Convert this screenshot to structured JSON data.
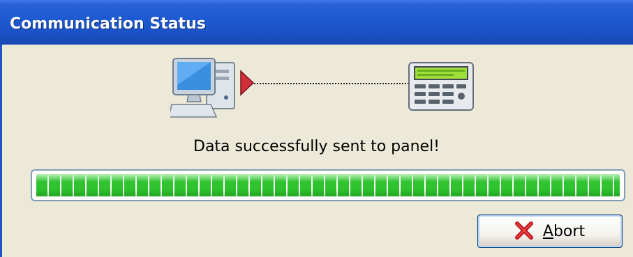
{
  "window": {
    "title": "Communication Status"
  },
  "status": {
    "message": "Data successfully sent to panel!"
  },
  "progress": {
    "percent": 100
  },
  "abort_button": {
    "mnemonic": "A",
    "label_rest": "bort"
  },
  "icons": {
    "computer": "computer-icon",
    "direction": "arrow-right-icon",
    "panel": "alarm-keypad-icon",
    "abort": "red-x-icon"
  },
  "colors": {
    "title_bar": "#1f5bd3",
    "window_bg": "#ece9d8",
    "progress_fill": "#2fc32f",
    "abort_x": "#c0141a"
  }
}
